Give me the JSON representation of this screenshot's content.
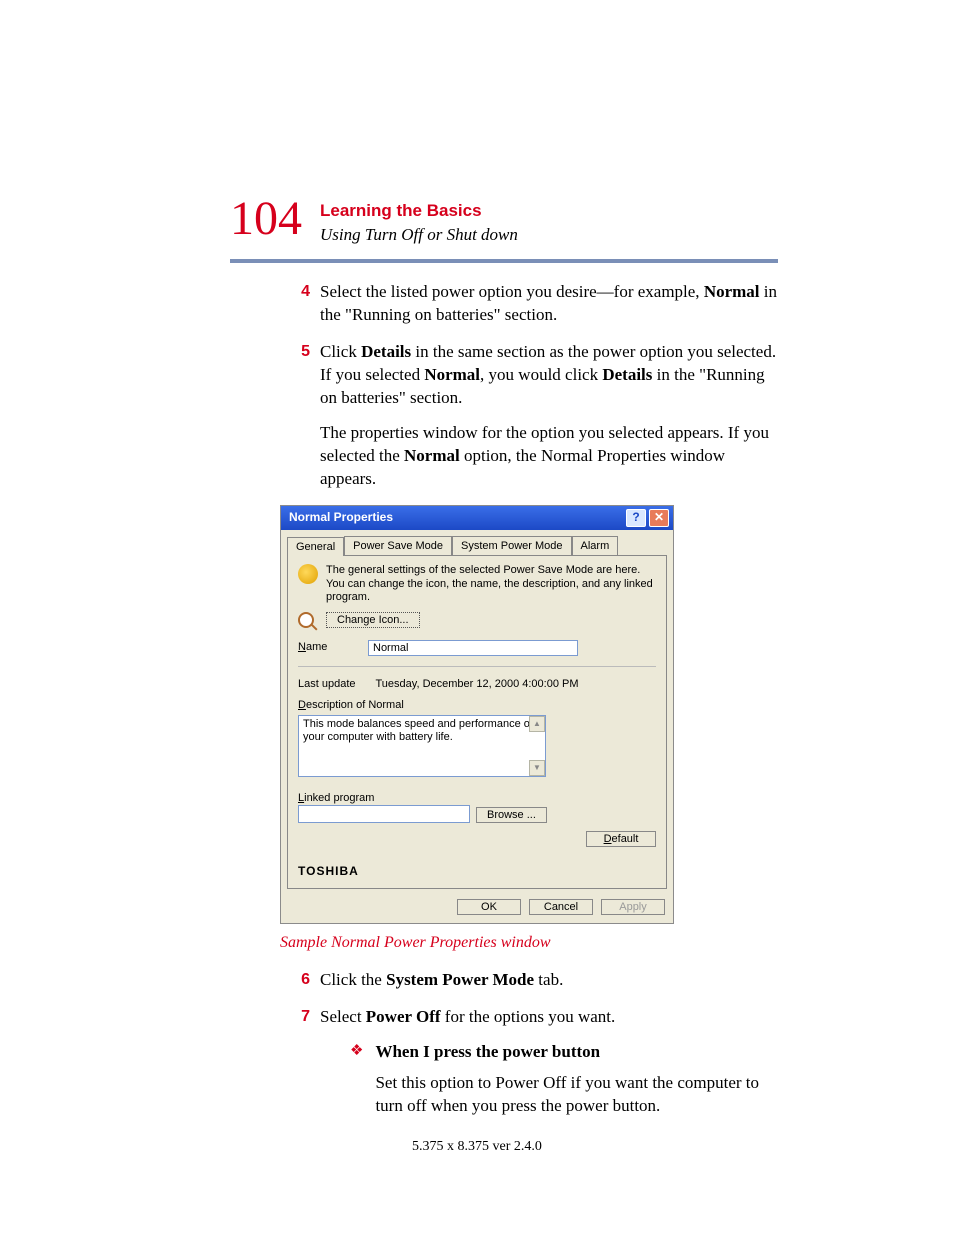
{
  "page_number": "104",
  "chapter_title": "Learning the Basics",
  "section_title": "Using Turn Off or Shut down",
  "steps": {
    "s4": {
      "num": "4",
      "text_before": "Select the listed power option you desire—for example, ",
      "bold1": "Normal",
      "text_after": " in the \"Running on batteries\" section."
    },
    "s5": {
      "num": "5",
      "p1_a": "Click ",
      "p1_b1": "Details",
      "p1_c": " in the same section as the power option you selected. If you selected ",
      "p1_b2": "Normal",
      "p1_d": ", you would click ",
      "p1_b3": "Details",
      "p1_e": " in the \"Running on batteries\" section.",
      "p2_a": "The properties window for the option you selected appears. If you selected the ",
      "p2_b": "Normal",
      "p2_c": " option, the Normal Properties window appears."
    },
    "s6": {
      "num": "6",
      "a": "Click the ",
      "b": "System Power Mode",
      "c": " tab."
    },
    "s7": {
      "num": "7",
      "a": "Select ",
      "b": "Power Off",
      "c": " for the options you want.",
      "bullet_title": "When I press the power button",
      "bullet_body": "Set this option to Power Off if you want the computer to turn off when you press the power button."
    }
  },
  "caption": "Sample Normal Power Properties window",
  "dialog": {
    "title": "Normal Properties",
    "help_glyph": "?",
    "close_glyph": "✕",
    "tabs": {
      "general": "General",
      "psm": "Power Save Mode",
      "spm": "System Power Mode",
      "alarm": "Alarm"
    },
    "info_text": "The general settings of the selected Power Save Mode are here.  You can change the icon, the name, the description, and any linked program.",
    "change_icon": "Change Icon...",
    "name_label": "Name",
    "name_value": "Normal",
    "last_update_label": "Last update",
    "last_update_value": "Tuesday, December 12, 2000 4:00:00 PM",
    "desc_label": "Description of Normal",
    "desc_value": "This mode balances speed and performance of your computer with battery life.",
    "linked_label": "Linked program",
    "browse": "Browse ...",
    "default": "Default",
    "brand": "TOSHIBA",
    "ok": "OK",
    "cancel": "Cancel",
    "apply": "Apply"
  },
  "footer": "5.375 x 8.375 ver 2.4.0"
}
